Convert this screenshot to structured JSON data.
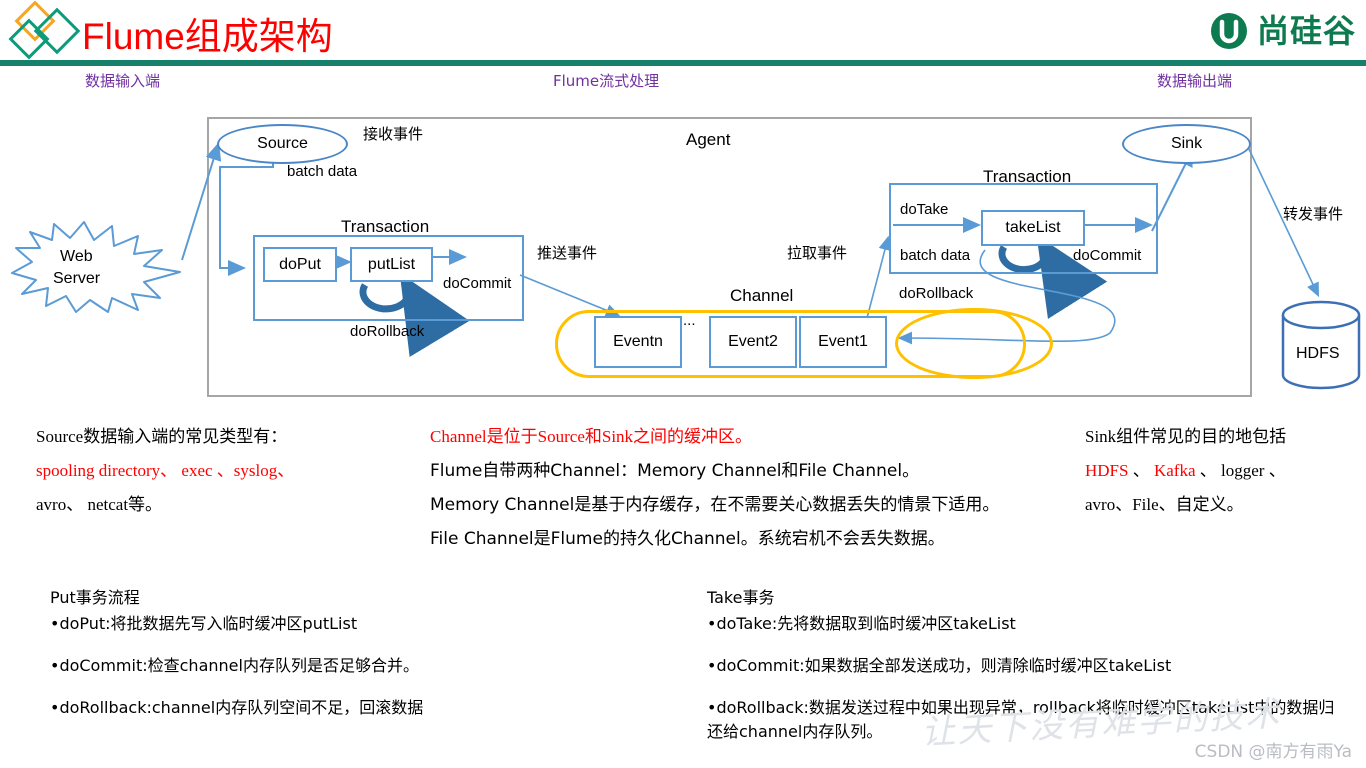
{
  "header": {
    "title": "Flume组成架构",
    "brand_text": "尚硅谷",
    "logo_icon": "diamonds-logo-icon",
    "brand_icon": "atguigu-u-icon"
  },
  "sections": {
    "input_heading": "数据输入端",
    "middle_heading": "Flume流式处理",
    "output_heading": "数据输出端"
  },
  "diagram": {
    "agent_label": "Agent",
    "source_label": "Source",
    "sink_label": "Sink",
    "web_server_label_line1": "Web",
    "web_server_label_line2": "Server",
    "hdfs_label": "HDFS",
    "channel_label": "Channel",
    "receive_event": "接收事件",
    "push_event": "推送事件",
    "pull_event": "拉取事件",
    "forward_event": "转发事件",
    "batch_data_left": "batch data",
    "batch_data_right": "batch data",
    "transaction_left": "Transaction",
    "transaction_right": "Transaction",
    "do_put": "doPut",
    "put_list": "putList",
    "do_commit_left": "doCommit",
    "do_rollback_left": "doRollback",
    "do_take": "doTake",
    "take_list": "takeList",
    "do_commit_right": "doCommit",
    "do_rollback_right": "doRollback",
    "events": [
      "Eventn",
      "Event2",
      "Event1"
    ],
    "ellipsis": "...",
    "colors": {
      "node_blue": "#5b9bd5",
      "channel_orange": "#ffc000",
      "agent_border": "#a6a6a6",
      "arrow_blue": "#5b9bd5",
      "loop_blue": "#2e6da4"
    }
  },
  "notes": {
    "left": {
      "line1": "Source数据输入端的常见类型有：",
      "line2_red": "spooling directory、 exec 、syslog、",
      "line3": "avro、 netcat等。"
    },
    "middle": {
      "line1_red": "Channel是位于Source和Sink之间的缓冲区。",
      "line2": "Flume自带两种Channel：Memory Channel和File Channel。",
      "line3": "Memory Channel是基于内存缓存，在不需要关心数据丢失的情景下适用。",
      "line4": "File Channel是Flume的持久化Channel。系统宕机不会丢失数据。"
    },
    "right": {
      "line1": "Sink组件常见的目的地包括",
      "line2_red_a": "HDFS",
      "line2_sep_a": " 、 ",
      "line2_red_b": "Kafka",
      "line2_sep_b": " 、 ",
      "line2_black": "logger",
      "line2_tail": " 、",
      "line3": "avro、File、自定义。"
    }
  },
  "flows": {
    "put": {
      "title": "Put事务流程",
      "items": [
        "•doPut:将批数据先写入临时缓冲区putList",
        "•doCommit:检查channel内存队列是否足够合并。",
        "•doRollback:channel内存队列空间不足，回滚数据"
      ]
    },
    "take": {
      "title": " Take事务",
      "items": [
        "•doTake:先将数据取到临时缓冲区takeList",
        "•doCommit:如果数据全部发送成功，则清除临时缓冲区takeList",
        "•doRollback:数据发送过程中如果出现异常，rollback将临时缓冲区takeList中的数据归还给channel内存队列。"
      ]
    }
  },
  "watermarks": {
    "brush": "让天下没有难学的技术",
    "csdn": "CSDN @南方有雨Ya"
  }
}
